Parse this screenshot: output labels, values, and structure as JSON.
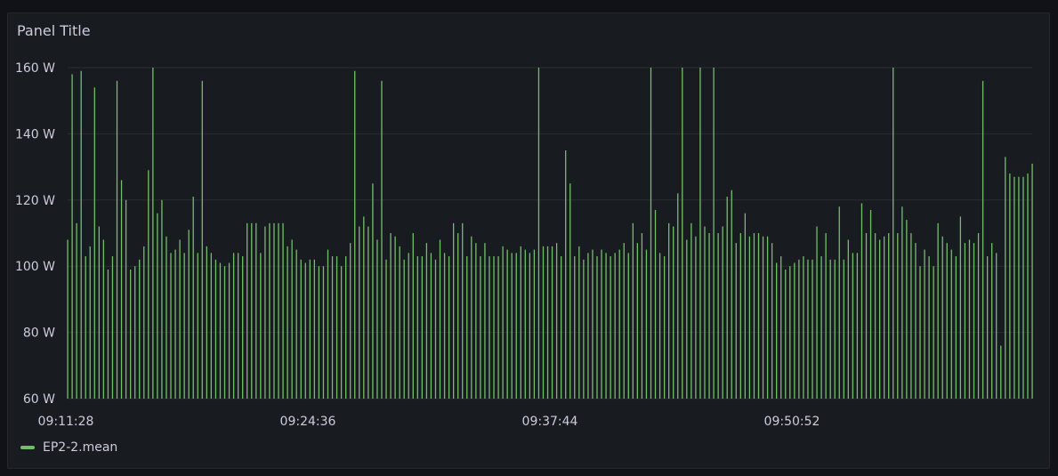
{
  "panel": {
    "title": "Panel Title"
  },
  "colors": {
    "series": "#73bf69",
    "background": "#181b1f",
    "grid": "#2a2d33",
    "text": "#ccccdc"
  },
  "chart_data": {
    "type": "bar",
    "title": "Panel Title",
    "ylim": [
      60,
      160
    ],
    "y_unit": "W",
    "y_ticks": [
      "60 W",
      "80 W",
      "100 W",
      "120 W",
      "140 W",
      "160 W"
    ],
    "x_tick_labels": [
      "09:11:28",
      "09:24:36",
      "09:37:44",
      "09:50:52"
    ],
    "grid": true,
    "legend_placement": "bottom-left",
    "series": [
      {
        "name": "EP2-2.mean",
        "values": [
          108,
          158,
          113,
          159,
          103,
          106,
          154,
          112,
          108,
          99,
          103,
          156,
          126,
          120,
          99,
          100,
          102,
          106,
          129,
          160,
          116,
          120,
          109,
          104,
          105,
          108,
          104,
          111,
          121,
          104,
          156,
          106,
          104,
          102,
          101,
          100,
          101,
          104,
          104,
          103,
          113,
          113,
          113,
          104,
          112,
          113,
          113,
          113,
          113,
          106,
          108,
          105,
          102,
          101,
          102,
          102,
          100,
          100,
          105,
          103,
          103,
          100,
          103,
          107,
          159,
          112,
          115,
          112,
          125,
          108,
          156,
          102,
          110,
          109,
          106,
          102,
          104,
          110,
          103,
          103,
          107,
          104,
          102,
          108,
          104,
          103,
          113,
          110,
          113,
          103,
          109,
          107,
          103,
          107,
          103,
          103,
          103,
          106,
          105,
          104,
          104,
          106,
          105,
          104,
          105,
          160,
          106,
          106,
          106,
          107,
          103,
          135,
          125,
          103,
          106,
          102,
          104,
          105,
          103,
          105,
          104,
          103,
          104,
          105,
          107,
          104,
          113,
          107,
          110,
          105,
          160,
          117,
          104,
          103,
          113,
          112,
          122,
          160,
          108,
          113,
          109,
          160,
          112,
          110,
          160,
          110,
          112,
          121,
          123,
          107,
          110,
          116,
          109,
          110,
          110,
          109,
          109,
          107,
          101,
          103,
          99,
          100,
          101,
          102,
          103,
          102,
          102,
          112,
          103,
          110,
          102,
          102,
          118,
          102,
          108,
          104,
          104,
          119,
          110,
          117,
          110,
          108,
          109,
          110,
          160,
          110,
          118,
          114,
          110,
          107,
          100,
          105,
          103,
          100,
          113,
          109,
          107,
          105,
          103,
          115,
          107,
          108,
          107,
          110,
          156,
          103,
          107,
          104,
          76,
          133,
          128,
          127,
          127,
          127,
          128,
          131
        ]
      }
    ]
  },
  "legend": {
    "series_label": "EP2-2.mean"
  }
}
